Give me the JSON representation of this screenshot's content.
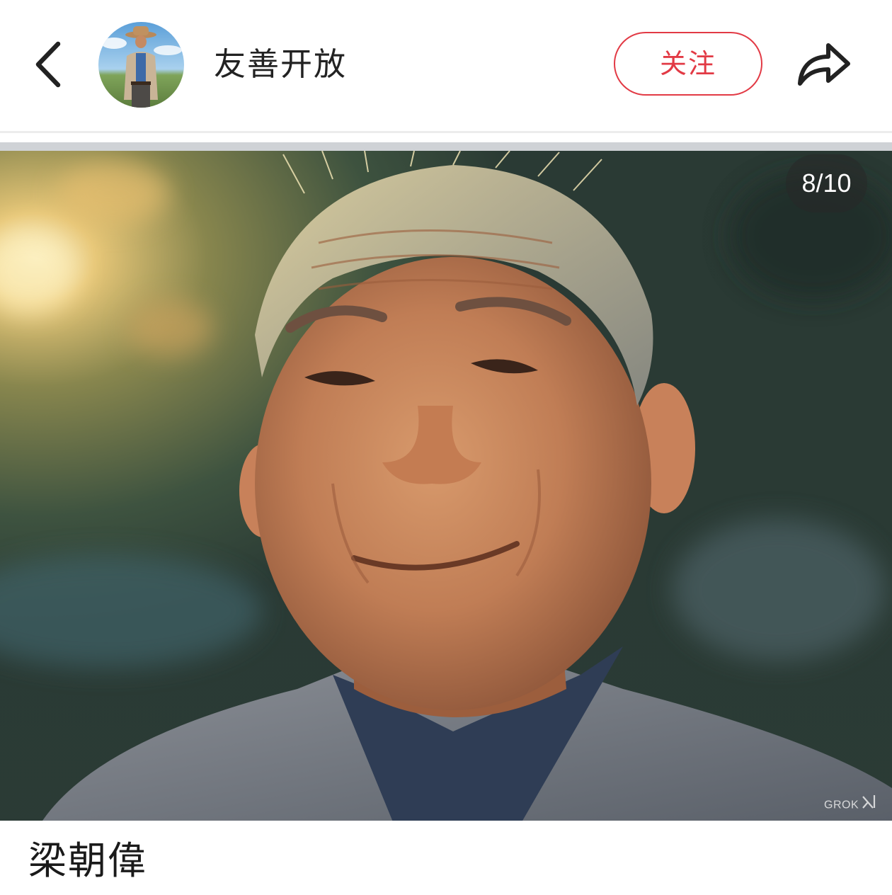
{
  "header": {
    "back_icon": "chevron-left-icon",
    "avatar_alt": "cowboy-hat-man-avatar",
    "username": "友善开放",
    "follow_label": "关注",
    "share_icon": "share-arrow-icon"
  },
  "gallery": {
    "counter": "8/10",
    "watermark": "GROK"
  },
  "post": {
    "caption": "梁朝偉"
  },
  "colors": {
    "accent": "#e23a45",
    "text": "#222222",
    "divider": "#cfd2d6"
  }
}
